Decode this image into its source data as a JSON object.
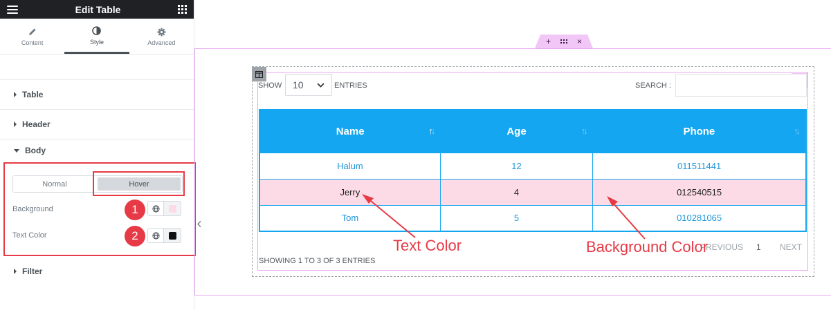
{
  "panel": {
    "title": "Edit Table",
    "tabs": [
      {
        "label": "Content",
        "icon": "pencil-icon"
      },
      {
        "label": "Style",
        "icon": "half-circle-icon"
      },
      {
        "label": "Advanced",
        "icon": "gear-icon"
      }
    ],
    "sections": {
      "table": "Table",
      "header": "Header",
      "body": "Body",
      "filter": "Filter"
    },
    "body_state": {
      "normal": "Normal",
      "hover": "Hover",
      "active": "Hover"
    },
    "controls": {
      "background_label": "Background",
      "background_color": "#fcdbe6",
      "text_color_label": "Text Color",
      "text_color": "#111111"
    },
    "badges": [
      "1",
      "2"
    ]
  },
  "canvas": {
    "handle_tab": {
      "add": "+",
      "close": "×"
    },
    "show_label": "SHOW",
    "entries_value": "10",
    "entries_label": "ENTRIES",
    "search_label": "SEARCH :",
    "search_value": "",
    "table": {
      "columns": [
        "Name",
        "Age",
        "Phone"
      ],
      "rows": [
        [
          "Halum",
          "12",
          "011511441"
        ],
        [
          "Jerry",
          "4",
          "012540515"
        ],
        [
          "Tom",
          "5",
          "010281065"
        ]
      ]
    },
    "pagination": {
      "previous": "PREVIOUS",
      "page": "1",
      "next": "NEXT"
    },
    "showing": "SHOWING 1 TO 3 OF 3 ENTRIES"
  },
  "annotations": {
    "text_color": "Text Color",
    "background_color": "Background Color"
  },
  "colors": {
    "accent_red": "#e63a46",
    "table_header": "#14a6f0",
    "hover_row": "#fcdbe6",
    "link_text": "#1e96d8"
  }
}
